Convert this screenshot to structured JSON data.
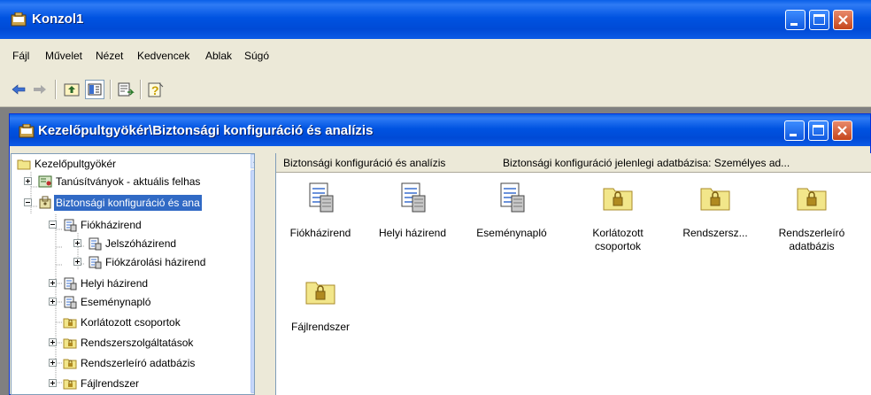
{
  "outer_window": {
    "title": "Konzol1"
  },
  "menu": [
    {
      "label": "Fájl"
    },
    {
      "label": "Művelet"
    },
    {
      "label": "Nézet"
    },
    {
      "label": "Kedvencek"
    },
    {
      "label": "Ablak"
    },
    {
      "label": "Súgó"
    }
  ],
  "toolbar": {
    "buttons": [
      "back-arrow-icon",
      "forward-arrow-icon",
      "up-one-level-icon",
      "show-hide-tree-icon",
      "export-list-icon",
      "help-icon"
    ]
  },
  "inner_window": {
    "title": "Kezelőpultgyökér\\Biztonsági konfiguráció és analízis"
  },
  "tree": {
    "items": [
      {
        "label": "Kezelőpultgyökér",
        "icon": "folder-icon"
      },
      {
        "label": "Tanúsítványok - aktuális felhas",
        "icon": "certificates-icon"
      },
      {
        "label": "Biztonsági konfiguráció és ana",
        "icon": "security-config-icon",
        "selected": true
      },
      {
        "label": "Fiókházirend",
        "icon": "policy-icon"
      },
      {
        "label": "Jelszóházirend",
        "icon": "policy-icon"
      },
      {
        "label": "Fiókzárolási házirend",
        "icon": "policy-icon"
      },
      {
        "label": "Helyi házirend",
        "icon": "policy-icon"
      },
      {
        "label": "Eseménynapló",
        "icon": "policy-icon"
      },
      {
        "label": "Korlátozott csoportok",
        "icon": "locked-folder-icon"
      },
      {
        "label": "Rendszerszolgáltatások",
        "icon": "locked-folder-icon"
      },
      {
        "label": "Rendszerleíró adatbázis",
        "icon": "locked-folder-icon"
      },
      {
        "label": "Fájlrendszer",
        "icon": "locked-folder-icon"
      }
    ]
  },
  "content": {
    "header_left": "Biztonsági konfiguráció és analízis",
    "header_right": "Biztonsági konfiguráció jelenlegi adatbázisa: Személyes ad...",
    "items": [
      {
        "label": "Fiókházirend",
        "icon": "policy-icon"
      },
      {
        "label": "Helyi házirend",
        "icon": "policy-icon"
      },
      {
        "label": "Eseménynapló",
        "icon": "policy-icon"
      },
      {
        "label": "Korlátozott csoportok",
        "icon": "locked-folder-icon"
      },
      {
        "label": "Rendszersz...",
        "icon": "locked-folder-icon"
      },
      {
        "label": "Rendszerleíró adatbázis",
        "icon": "locked-folder-icon"
      },
      {
        "label": "Fájlrendszer",
        "icon": "locked-folder-icon"
      }
    ]
  },
  "colors": {
    "titlebar": "#0054e3",
    "selection": "#316ac5",
    "folder": "#f2e68a"
  }
}
